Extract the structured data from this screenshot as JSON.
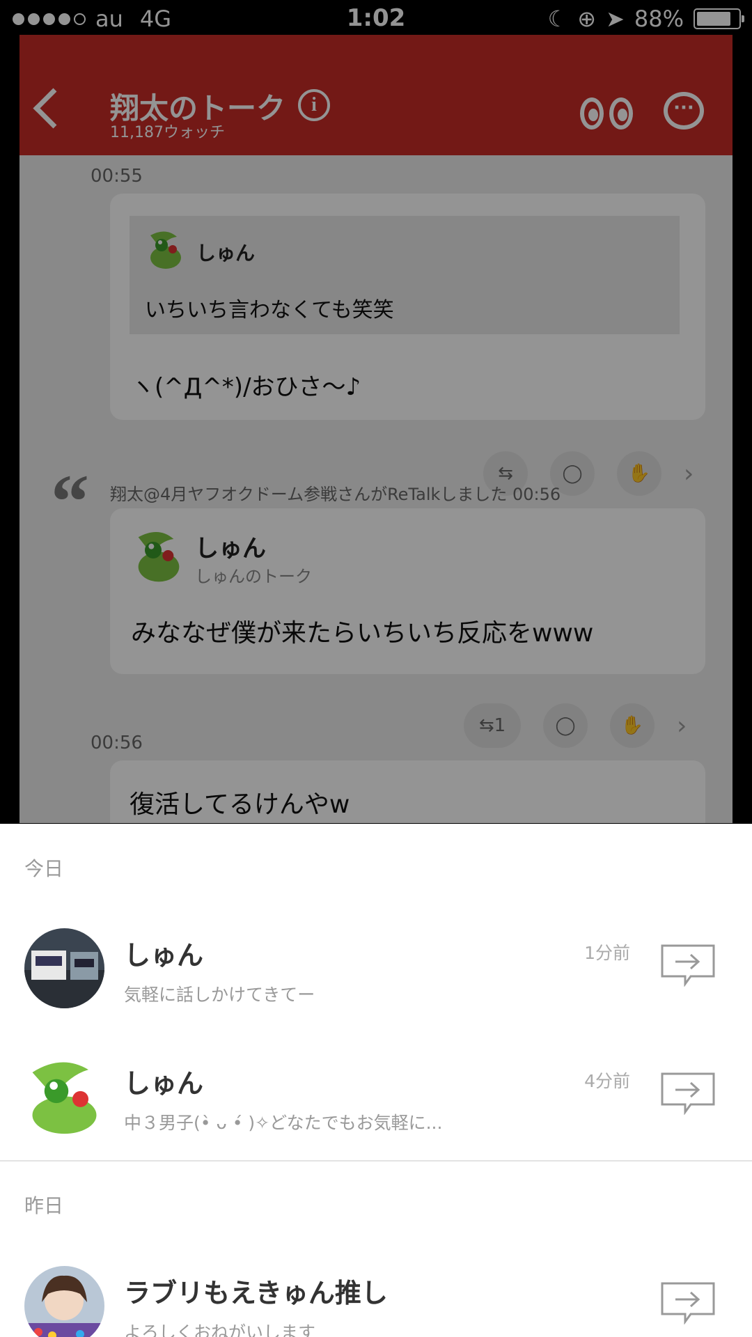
{
  "status": {
    "carrier": "au",
    "network": "4G",
    "time": "1:02",
    "battery": "88%",
    "battery_level": 0.88
  },
  "chat": {
    "title": "翔太のトーク",
    "watch_count": "11,187ウォッチ",
    "info_glyph": "i",
    "more_glyph": "···",
    "messages": [
      {
        "time": "00:55",
        "quote_name": "しゅん",
        "quote_text": "いちいち言わなくても笑笑",
        "text": "ヽ(^Д^*)/おひさ～♪"
      },
      {
        "retalk": "翔太@4月ヤフオクドーム参戦さんがReTalkしました 00:56",
        "name": "しゅん",
        "source": "しゅんのトーク",
        "text": "みななぜ僕が来たらいちいち反応をwww",
        "retalk_count": "1"
      },
      {
        "time": "00:56",
        "text": "復活してるけんやw"
      }
    ]
  },
  "sheet": {
    "today_label": "今日",
    "yesterday_label": "昨日",
    "today": [
      {
        "name": "しゅん",
        "desc": "気軽に話しかけてきてー",
        "ago": "1分前",
        "avatar": "train-photo"
      },
      {
        "name": "しゅん",
        "desc": "中３男子(•̀ ᴗ •́ )✧どなたでもお気軽に...",
        "ago": "4分前",
        "avatar": "yoshi"
      }
    ],
    "yesterday": [
      {
        "name": "ラブリもえきゅん推し",
        "desc": "よろしくおねがいします",
        "avatar": "person-photo"
      }
    ]
  }
}
